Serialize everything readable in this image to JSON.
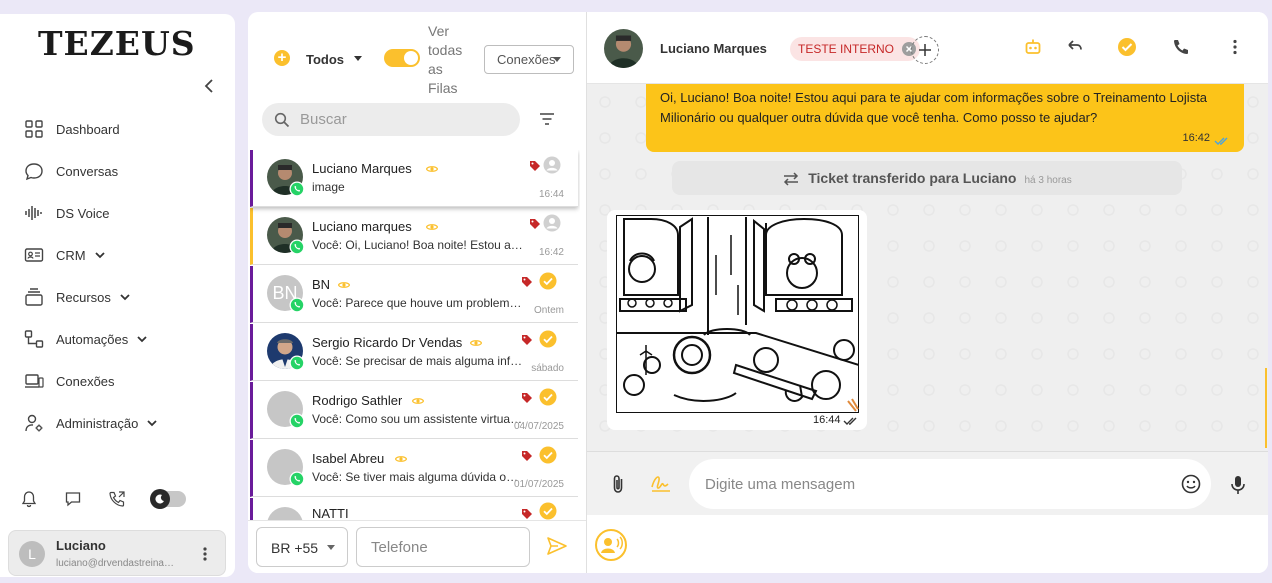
{
  "sidebar": {
    "logo": "TEZEUS",
    "nav": [
      {
        "label": "Dashboard",
        "icon": "dashboard-grid-icon"
      },
      {
        "label": "Conversas",
        "icon": "chat-bubble-icon"
      },
      {
        "label": "DS Voice",
        "icon": "voice-wave-icon"
      },
      {
        "label": "CRM",
        "icon": "id-card-icon",
        "expandable": true
      },
      {
        "label": "Recursos",
        "icon": "stack-icon",
        "expandable": true
      },
      {
        "label": "Automações",
        "icon": "flow-icon",
        "expandable": true
      },
      {
        "label": "Conexões",
        "icon": "devices-icon"
      },
      {
        "label": "Administração",
        "icon": "user-gear-icon",
        "expandable": true
      }
    ],
    "user": {
      "initial": "L",
      "name": "Luciano",
      "email": "luciano@drvendastreinamentos.com"
    }
  },
  "list": {
    "filter_label": "Todos",
    "queue_toggle_label": "Ver todas as Filas",
    "connections_select": "Conexões",
    "search_placeholder": "Buscar",
    "tickets": [
      {
        "name": "Luciano Marques",
        "message": "image",
        "time": "16:44",
        "status": "pending",
        "avatar": "photo"
      },
      {
        "name": "Luciano marques",
        "message": "Você:  Oi, Luciano! Boa noite! Estou aqui para te ajudar",
        "time": "16:42",
        "status": "pending",
        "avatar": "photo"
      },
      {
        "name": "BN",
        "message": "Você:  Parece que houve um problema com a sua mensagem",
        "time": "Ontem",
        "status": "done",
        "avatar": "initials",
        "initials": "BN"
      },
      {
        "name": "Sergio Ricardo Dr Vendas",
        "message": "Você:  Se precisar de mais alguma informação, estou aqui",
        "time": "sábado",
        "status": "done",
        "avatar": "photo2"
      },
      {
        "name": "Rodrigo Sathler",
        "message": "Você: Como sou um assistente virtual, não consigo",
        "time": "04/07/2025",
        "status": "done",
        "avatar": "grey"
      },
      {
        "name": "Isabel Abreu",
        "message": "Você: Se tiver mais alguma dúvida ou precisar de ajuda",
        "time": "01/07/2025",
        "status": "done",
        "avatar": "grey"
      },
      {
        "name": "NATTI",
        "message": "",
        "time": "",
        "status": "done",
        "avatar": "grey"
      }
    ],
    "country_code": "BR +55",
    "phone_placeholder": "Telefone"
  },
  "chat": {
    "contact_name": "Luciano Marques",
    "tag": "TESTE INTERNO",
    "outgoing_message": "Oi, Luciano! Boa noite! Estou aqui para te ajudar com informações sobre o Treinamento Lojista Milionário ou qualquer outra dúvida que você tenha. Como posso te ajudar?",
    "outgoing_time": "16:42",
    "system_message": "Ticket transferido para Luciano",
    "system_time": "há 3 horas",
    "image_time": "16:44",
    "input_placeholder": "Digite uma mensagem"
  },
  "colors": {
    "accent": "#fbc02d",
    "bubble_out": "#fcc419",
    "ticket_border_active": "#6a1b9a",
    "tag_bg": "#fbe4e4",
    "tag_text": "#c62828",
    "whatsapp": "#25d366"
  }
}
